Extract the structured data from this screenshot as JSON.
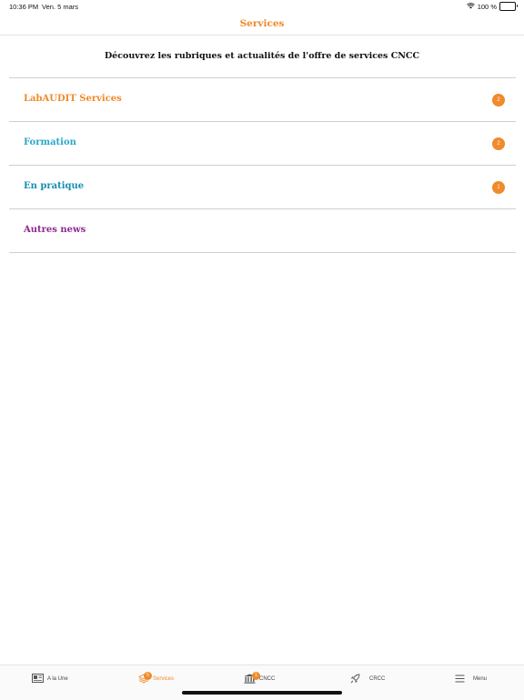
{
  "status_bar": {
    "time": "10:36 PM",
    "date": "Ven. 5 mars",
    "battery": "100 %"
  },
  "nav": {
    "title": "Services"
  },
  "intro": "Découvrez les rubriques et actualités de l'offre de services CNCC",
  "sections": [
    {
      "label": "LabAUDIT Services",
      "color": "#f08a2a",
      "badge": "2"
    },
    {
      "label": "Formation",
      "color": "#2aa8c9",
      "badge": "2"
    },
    {
      "label": "En pratique",
      "color": "#168fb0",
      "badge": "1"
    },
    {
      "label": "Autres news",
      "color": "#8e2a8f",
      "badge": ""
    }
  ],
  "tabs": [
    {
      "label": "A la Une",
      "icon": "newspaper-icon",
      "badge": ""
    },
    {
      "label": "Services",
      "icon": "layers-icon",
      "badge": "5"
    },
    {
      "label": "CNCC",
      "icon": "building-icon",
      "badge": "1"
    },
    {
      "label": "CRCC",
      "icon": "rocket-icon",
      "badge": ""
    },
    {
      "label": "Menu",
      "icon": "menu-icon",
      "badge": ""
    }
  ],
  "colors": {
    "accent": "#f08a2a"
  }
}
